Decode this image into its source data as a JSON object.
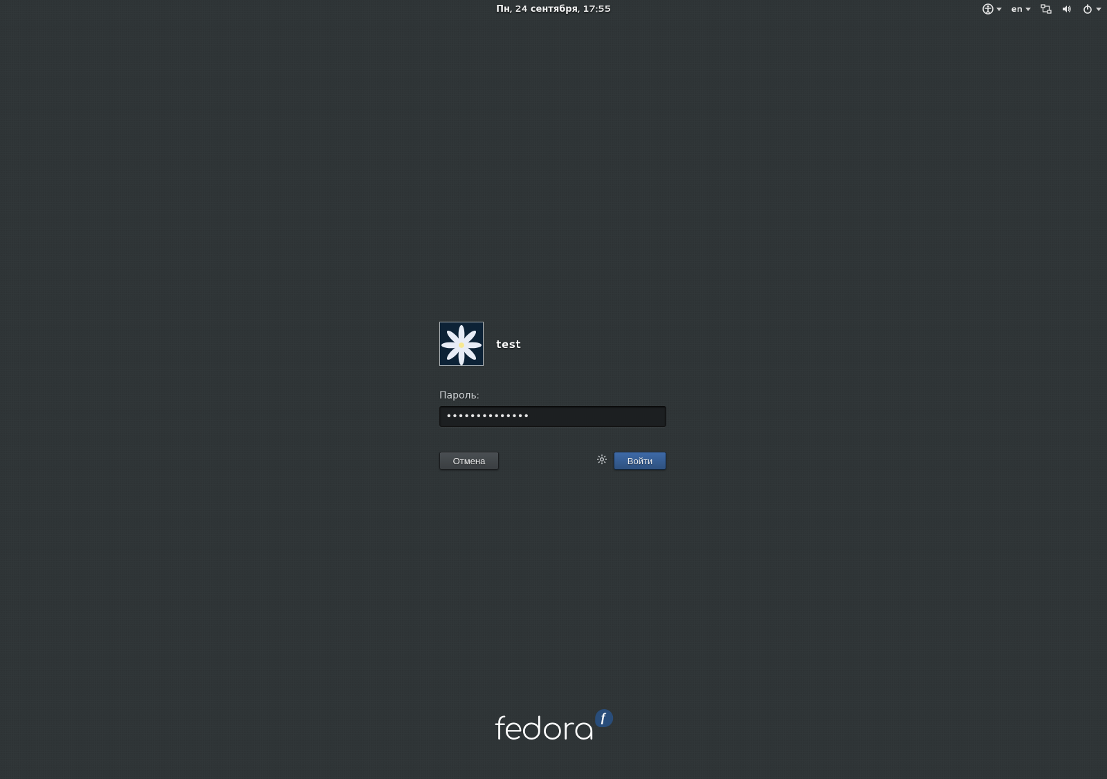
{
  "panel": {
    "clock": "Пн, 24 сентября, 17:55",
    "language": "en"
  },
  "login": {
    "username": "test",
    "password_label": "Пароль:",
    "password_value": "••••••••••••••",
    "cancel_label": "Отмена",
    "login_label": "Войти"
  },
  "branding": {
    "distro_name": "fedora"
  }
}
